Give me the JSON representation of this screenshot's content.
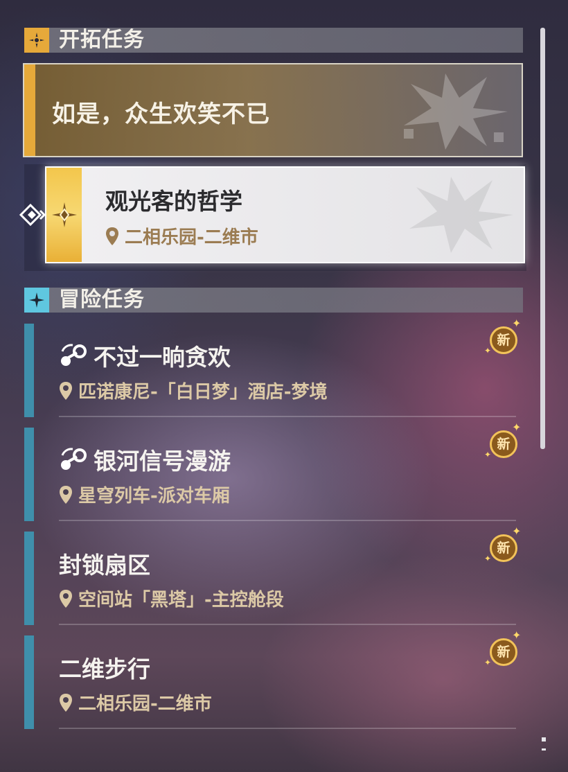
{
  "trailblaze": {
    "header": "开拓任务",
    "icon": "trailblaze-star-icon",
    "main_mission": "如是，众生欢笑不已",
    "sub_mission": {
      "title": "观光客的哲学",
      "location": "二相乐园-二维市"
    }
  },
  "adventure": {
    "header": "冒险任务",
    "icon": "adventure-star-icon",
    "items": [
      {
        "title": "不过一晌贪欢",
        "location": "匹诺康尼-「白日梦」酒店-梦境",
        "badge": "新",
        "icon": "event-icon"
      },
      {
        "title": "银河信号漫游",
        "location": "星穹列车-派对车厢",
        "badge": "新",
        "icon": "event-icon"
      },
      {
        "title": "封锁扇区",
        "location": "空间站「黑塔」-主控舱段",
        "badge": "新"
      },
      {
        "title": "二维步行",
        "location": "二相乐园-二维市",
        "badge": "新"
      }
    ]
  },
  "colors": {
    "gold": "#e6a93a",
    "teal": "#3f8fab",
    "location": "#dcc9a6"
  }
}
